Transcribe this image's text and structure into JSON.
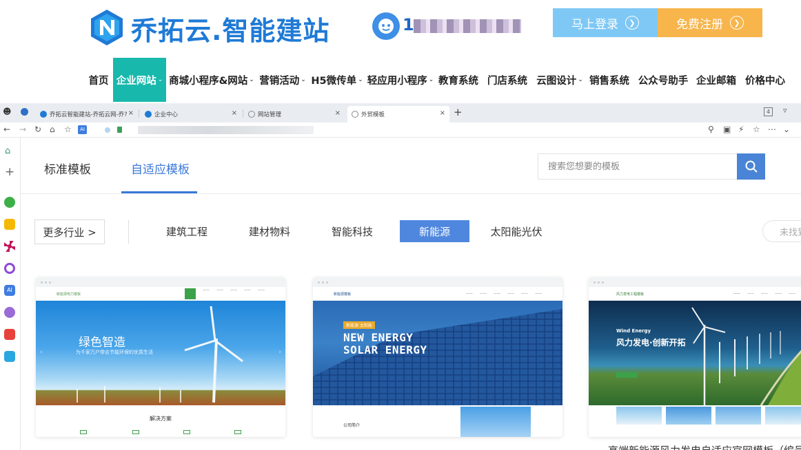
{
  "header": {
    "brand_text": "乔拓云.智能建站",
    "phone_prefix": "1",
    "login_label": "马上登录",
    "register_label": "免费注册"
  },
  "nav": {
    "items": [
      {
        "label": "首页"
      },
      {
        "label": "企业网站"
      },
      {
        "label": "商城小程序&网站"
      },
      {
        "label": "营销活动"
      },
      {
        "label": "H5微传单"
      },
      {
        "label": "轻应用小程序"
      },
      {
        "label": "教育系统"
      },
      {
        "label": "门店系统"
      },
      {
        "label": "云图设计"
      },
      {
        "label": "销售系统"
      },
      {
        "label": "公众号助手"
      },
      {
        "label": "企业邮箱"
      },
      {
        "label": "价格中心"
      }
    ]
  },
  "browser": {
    "tabs": [
      {
        "label": "乔拓云智能建站-乔拓云网-乔?"
      },
      {
        "label": "企业中心"
      },
      {
        "label": "网站管理"
      },
      {
        "label": "外贸模板"
      }
    ],
    "tab_count": "4"
  },
  "page": {
    "tabs": [
      {
        "label": "标准模板"
      },
      {
        "label": "自适应模板"
      }
    ],
    "search_placeholder": "搜索您想要的模板",
    "more_industry_label": "更多行业 >",
    "categories": [
      {
        "label": "建筑工程"
      },
      {
        "label": "建材物料"
      },
      {
        "label": "智能科技"
      },
      {
        "label": "新能源"
      },
      {
        "label": "太阳能光伏"
      }
    ],
    "not_found_label": "未找到",
    "cards": [
      {
        "site_title": "新能源电力模板",
        "hero_title": "绿色智造",
        "hero_subtitle": "为千家万户带去节能环保的优质生活",
        "section_label": "解决方案"
      },
      {
        "site_title": "新能源模板",
        "hero_badge": "新能源 太阳能",
        "hero_line1": "NEW ENERGY",
        "hero_line2": "SOLAR ENERGY",
        "section_label": "公司简介"
      },
      {
        "site_title": "风力发电工程模板",
        "hero_kicker": "Wind Energy",
        "hero_title": "风力发电·创新开拓"
      }
    ],
    "partial_caption": "高端新能源风力发电自适应官网模板（编号"
  }
}
